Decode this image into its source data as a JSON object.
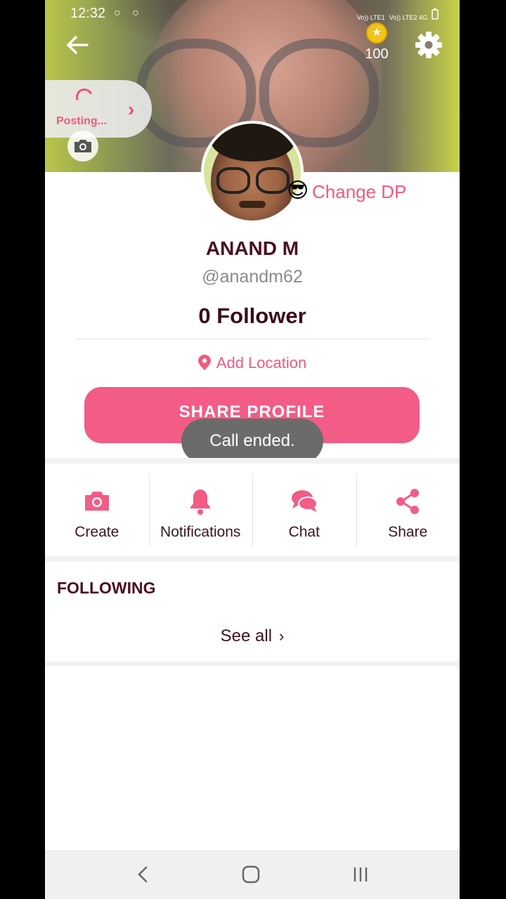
{
  "status_bar": {
    "time": "12:32",
    "icons": "○ ○",
    "network": [
      "Vo)) LTE1",
      "Vo)) LTE2 4G"
    ]
  },
  "header": {
    "coins": "100"
  },
  "posting": {
    "label": "Posting..."
  },
  "profile": {
    "change_dp_label": "Change DP",
    "emoji": "😎",
    "name": "ANAND M",
    "handle": "@anandm62",
    "followers": "0 Follower",
    "add_location_label": "Add Location",
    "share_profile_label": "SHARE PROFILE"
  },
  "toast": {
    "text": "Call ended."
  },
  "actions": [
    {
      "label": "Create",
      "icon": "camera-icon"
    },
    {
      "label": "Notifications",
      "icon": "bell-icon"
    },
    {
      "label": "Chat",
      "icon": "chat-bubbles-icon"
    },
    {
      "label": "Share",
      "icon": "share-icon"
    }
  ],
  "following": {
    "title": "FOLLOWING",
    "see_all_label": "See all"
  },
  "colors": {
    "accent": "#f25c86",
    "title": "#4a1020"
  }
}
